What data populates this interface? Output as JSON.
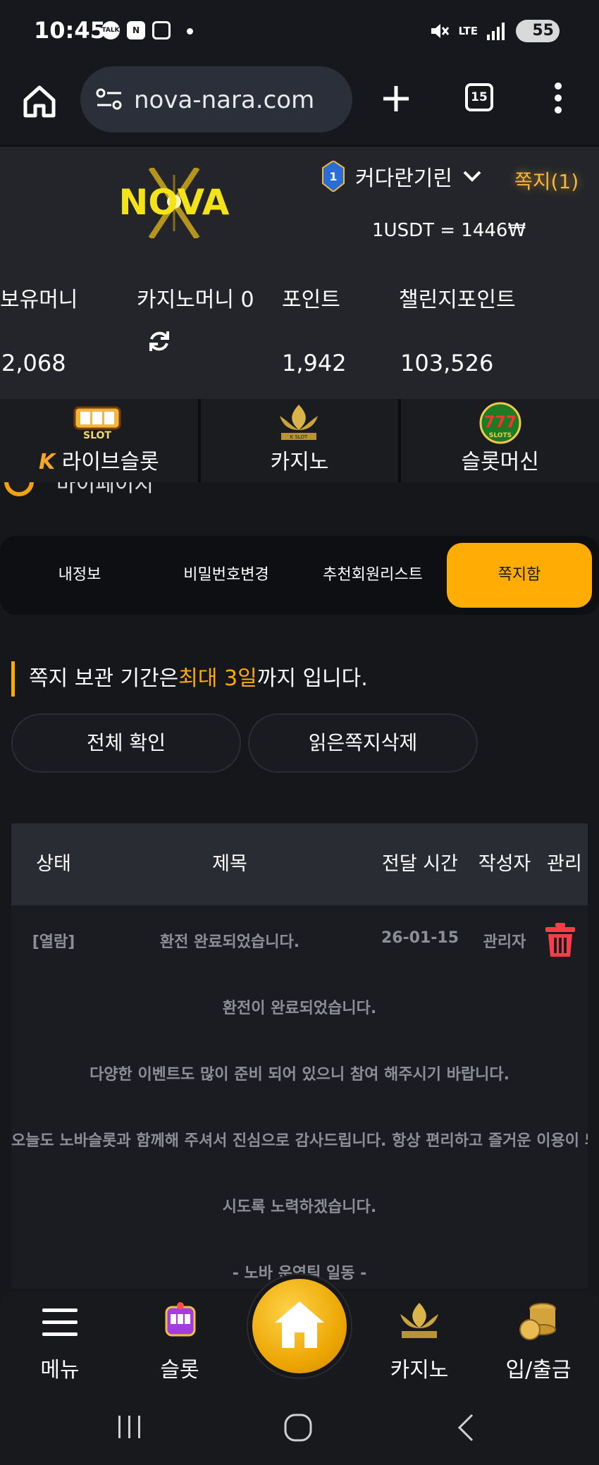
{
  "status_bar": {
    "time": "10:45",
    "notif_icons": [
      "TALK",
      "N"
    ],
    "network": "LTE",
    "battery": "55"
  },
  "browser": {
    "url": "nova-nara.com",
    "tab_count": "15"
  },
  "header": {
    "logo_text": "NOVA",
    "level": "1",
    "username": "커다란기린",
    "messages_badge": "쪽지(1)",
    "exchange_rate": "1USDT = 1446₩"
  },
  "balances": {
    "holding_label": "보유머니",
    "holding_value": "2,068",
    "casino_label": "카지노머니 0",
    "point_label": "포인트",
    "point_value": "1,942",
    "challenge_label": "챌린지포인트",
    "challenge_value": "103,526"
  },
  "game_categories": [
    {
      "label": "라이브슬롯",
      "prefix": "K",
      "icon": "live-slot-icon"
    },
    {
      "label": "카지노",
      "icon": "k-slot-icon"
    },
    {
      "label": "슬롯머신",
      "icon": "777-slots-icon"
    }
  ],
  "peek_text": "마이페이지",
  "tabs": [
    "내정보",
    "비밀번호변경",
    "추천회원리스트",
    "쪽지함"
  ],
  "active_tab": 3,
  "notice": {
    "before": "쪽지 보관 기간은",
    "highlight": "최대 3일",
    "after": "까지 입니다."
  },
  "actions": {
    "confirm_all": "전체 확인",
    "delete_read": "읽은쪽지삭제"
  },
  "table": {
    "headers": [
      "상태",
      "제목",
      "전달 시간",
      "작성자",
      "관리"
    ],
    "rows": [
      {
        "status": "[열람]",
        "title": "환전 완료되었습니다.",
        "time": "26-01-15",
        "author": "관리자"
      }
    ],
    "message_lines": [
      "환전이 완료되었습니다.",
      "다양한 이벤트도 많이 준비 되어 있으니 참여 해주시기 바랍니다.",
      "오늘도 노바슬롯과 함께해 주셔서 진심으로 감사드립니다. 항상 편리하고 즐거운 이용이 되",
      "시도록 노력하겠습니다.",
      "- 노바 운영팀 일동 -"
    ]
  },
  "bottom_nav": [
    {
      "label": "메뉴",
      "icon": "hamburger-icon"
    },
    {
      "label": "슬롯",
      "icon": "slot-machine-icon"
    },
    {
      "label": "",
      "icon": "home-icon"
    },
    {
      "label": "카지노",
      "icon": "k-slot-icon"
    },
    {
      "label": "입/출금",
      "icon": "coins-icon"
    }
  ],
  "colors": {
    "accent": "#ffac04",
    "danger": "#ff3b47",
    "bg": "#16171b"
  }
}
